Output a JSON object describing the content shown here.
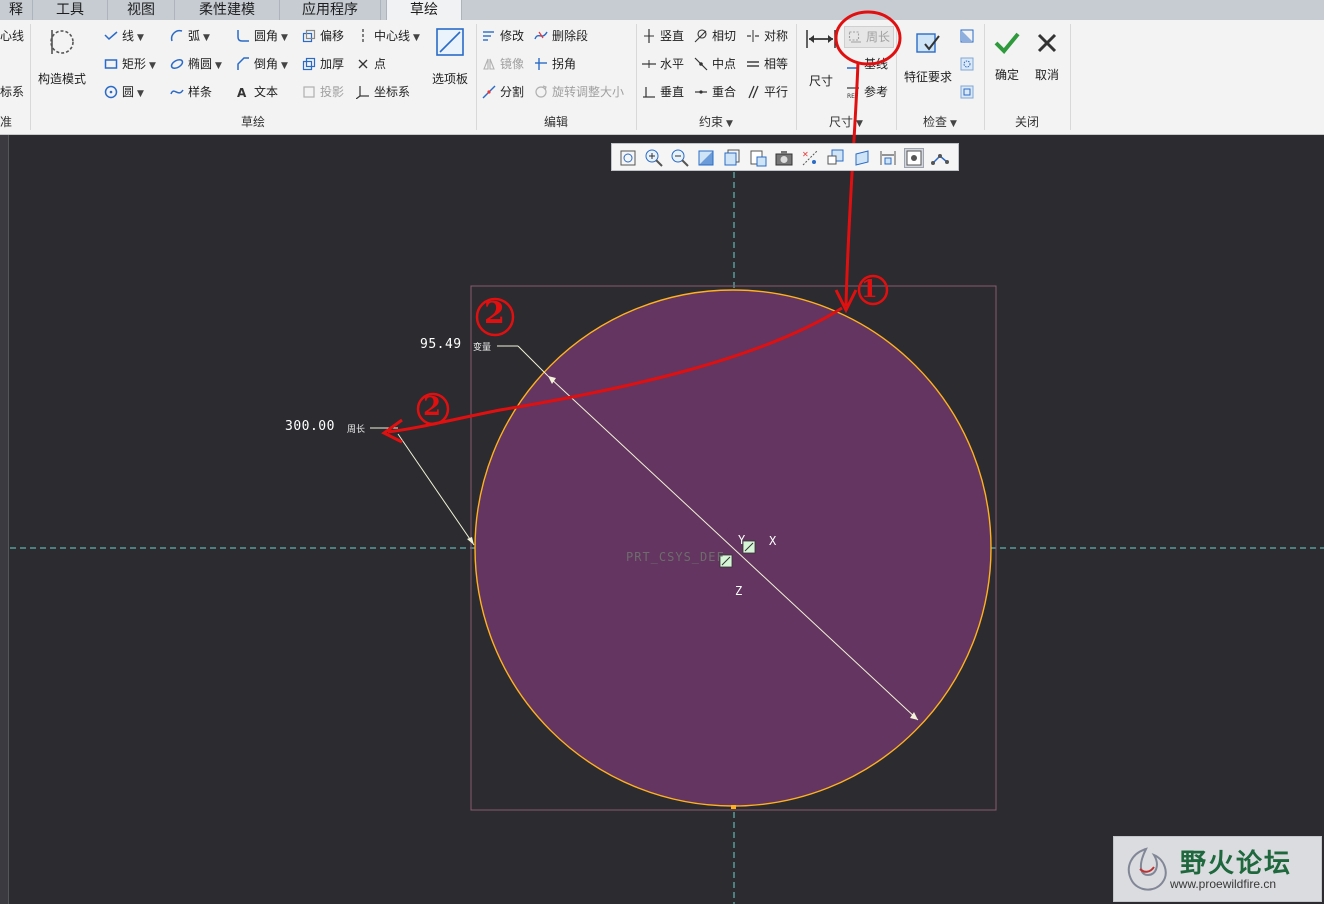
{
  "tabs": [
    {
      "label": "释"
    },
    {
      "label": "工具"
    },
    {
      "label": "视图"
    },
    {
      "label": "柔性建模"
    },
    {
      "label": "应用程序"
    },
    {
      "label": "草绘"
    }
  ],
  "ribbon": {
    "edge": {
      "center_line": "心线",
      "coord": "标系",
      "footer": "准"
    },
    "construct_mode": "构造模式",
    "sketch": {
      "line": "线",
      "arc": "弧",
      "fillet": "圆角",
      "offset": "偏移",
      "centerline": "中心线",
      "rectangle": "矩形",
      "ellipse": "椭圆",
      "chamfer": "倒角",
      "thicken": "加厚",
      "point": "点",
      "circle": "圆",
      "spline": "样条",
      "text": "文本",
      "project": "投影",
      "csys": "坐标系",
      "palette": "选项板",
      "footer": "草绘"
    },
    "edit": {
      "modify": "修改",
      "delete_segment": "删除段",
      "mirror": "镜像",
      "corner": "拐角",
      "divide": "分割",
      "rotate_resize": "旋转调整大小",
      "footer": "编辑"
    },
    "constrain": {
      "vertical": "竖直",
      "tangent": "相切",
      "symmetric": "对称",
      "horizontal": "水平",
      "midpoint": "中点",
      "equal": "相等",
      "perpendicular": "垂直",
      "coincident": "重合",
      "parallel": "平行",
      "footer": "约束"
    },
    "dimension": {
      "dimension": "尺寸",
      "perimeter": "周长",
      "baseline": "基线",
      "reference": "参考",
      "footer": "尺寸"
    },
    "inspect": {
      "feature_req": "特征要求",
      "footer": "检查"
    },
    "close": {
      "ok": "确定",
      "cancel": "取消",
      "footer": "关闭"
    }
  },
  "canvas": {
    "dim_diameter": "95.49",
    "dim_diameter_tag": "变量",
    "dim_perimeter": "300.00",
    "dim_perimeter_tag": "周长",
    "csys_label": "PRT_CSYS_DEF",
    "axis_x": "X",
    "axis_y": "Y",
    "axis_z": "Z",
    "colors": {
      "circle_fill": "#633560",
      "circle_edge": "#ffb21e",
      "axis": "#6fd0d0",
      "annotation": "#e01010"
    }
  },
  "annotations": {
    "n1": "1",
    "n2a": "2",
    "n2b": "2"
  },
  "watermark": {
    "title": "野火论坛",
    "url": "www.proewildfire.cn"
  }
}
